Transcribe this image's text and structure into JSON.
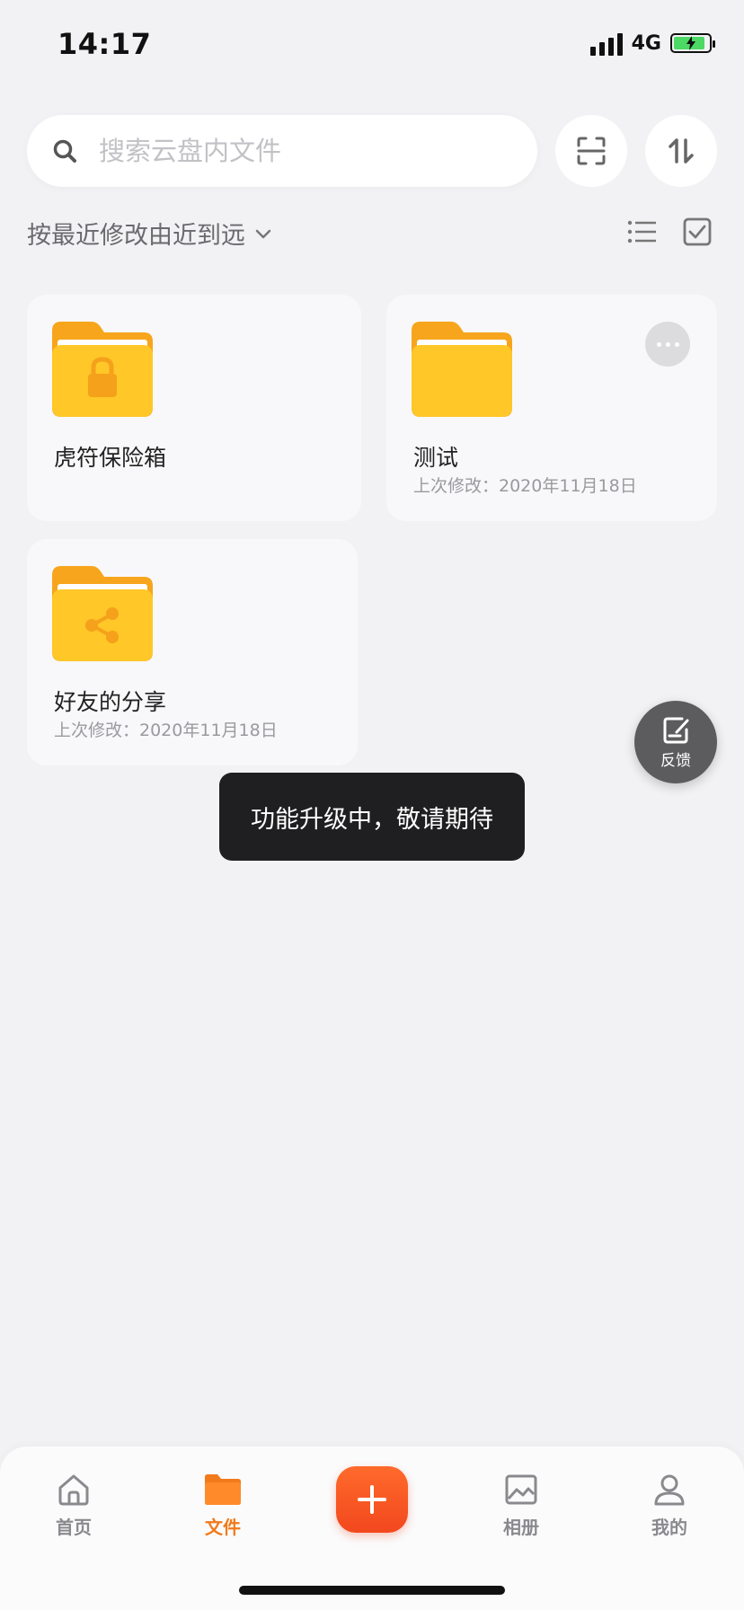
{
  "status_bar": {
    "time": "14:17",
    "network": "4G"
  },
  "search": {
    "placeholder": "搜索云盘内文件"
  },
  "sort": {
    "label": "按最近修改由近到远"
  },
  "files": [
    {
      "name": "虎符保险箱",
      "modified": ""
    },
    {
      "name": "测试",
      "modified": "上次修改：2020年11月18日"
    },
    {
      "name": "好友的分享",
      "modified": "上次修改：2020年11月18日"
    }
  ],
  "feedback": {
    "label": "反馈"
  },
  "toast": {
    "message": "功能升级中，敬请期待"
  },
  "nav": {
    "items": [
      {
        "label": "首页"
      },
      {
        "label": "文件"
      },
      {
        "label": "相册"
      },
      {
        "label": "我的"
      }
    ]
  },
  "colors": {
    "accent": "#f27a1a",
    "folder": "#ffc727",
    "folder_tab": "#f7a51c",
    "add_button": "#f2481e"
  }
}
